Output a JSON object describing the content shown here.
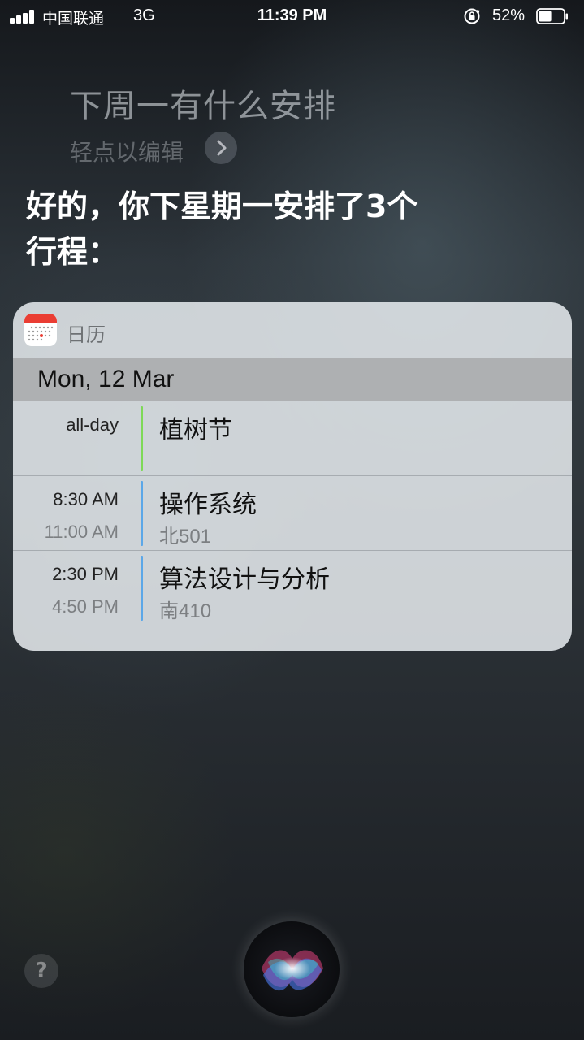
{
  "status_bar": {
    "carrier": "中国联通",
    "network": "3G",
    "time": "11:39 PM",
    "battery_percent": "52%",
    "battery_level": 0.52
  },
  "siri": {
    "query": "下周一有什么安排",
    "edit_hint": "轻点以编辑",
    "response_line1": "好的，你下星期一安排了3个",
    "response_line2": "行程："
  },
  "calendar_card": {
    "app_name": "日历",
    "date": "Mon, 12 Mar",
    "events": [
      {
        "start": "all-day",
        "end": "",
        "title": "植树节",
        "location": "",
        "color": "#7ed957"
      },
      {
        "start": "8:30 AM",
        "end": "11:00 AM",
        "title": "操作系统",
        "location": "北501",
        "color": "#5ba7e8"
      },
      {
        "start": "2:30 PM",
        "end": "4:50 PM",
        "title": "算法设计与分析",
        "location": "南410",
        "color": "#5ba7e8"
      }
    ]
  },
  "controls": {
    "help_label": "?"
  },
  "colors": {
    "calendar_icon_red": "#ea3d33",
    "all_day_bar": "#7ed957",
    "event_bar": "#5ba7e8"
  }
}
